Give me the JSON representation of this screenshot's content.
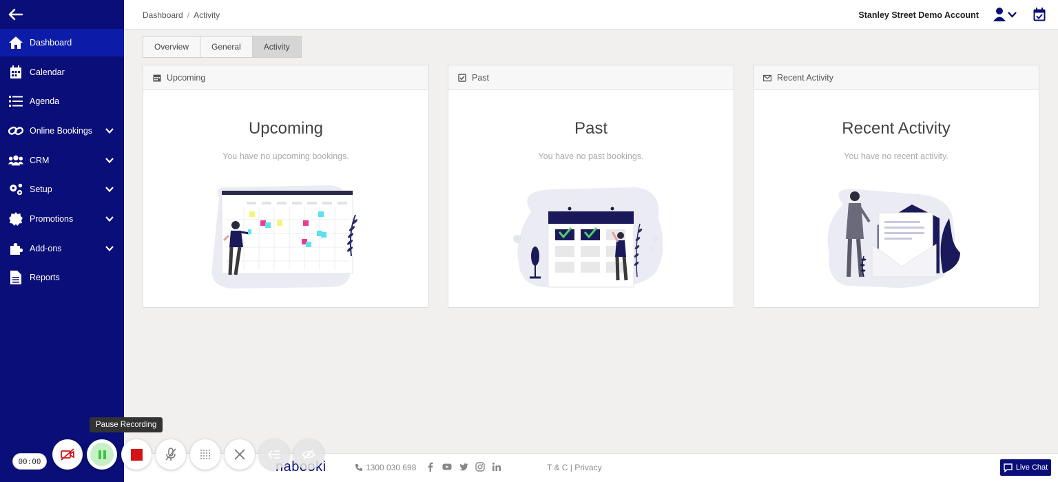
{
  "sidebar": {
    "items": [
      {
        "label": "Dashboard",
        "icon": "home-icon",
        "active": true
      },
      {
        "label": "Calendar",
        "icon": "calendar-icon"
      },
      {
        "label": "Agenda",
        "icon": "list-icon"
      },
      {
        "label": "Online Bookings",
        "icon": "link-icon",
        "expandable": true
      },
      {
        "label": "CRM",
        "icon": "users-icon",
        "expandable": true
      },
      {
        "label": "Setup",
        "icon": "cogs-icon",
        "expandable": true
      },
      {
        "label": "Promotions",
        "icon": "badge-icon",
        "expandable": true
      },
      {
        "label": "Add-ons",
        "icon": "puzzle-icon",
        "expandable": true
      },
      {
        "label": "Reports",
        "icon": "file-icon"
      }
    ]
  },
  "header": {
    "breadcrumb": {
      "root": "Dashboard",
      "sep": "/",
      "current": "Activity"
    },
    "account": "Stanley Street Demo Account"
  },
  "tabs": [
    {
      "label": "Overview"
    },
    {
      "label": "General"
    },
    {
      "label": "Activity",
      "active": true
    }
  ],
  "cards": [
    {
      "header": "Upcoming",
      "title": "Upcoming",
      "subtitle": "You have no upcoming bookings."
    },
    {
      "header": "Past",
      "title": "Past",
      "subtitle": "You have no past bookings."
    },
    {
      "header": "Recent Activity",
      "title": "Recent Activity",
      "subtitle": "You have no recent activity."
    }
  ],
  "footer": {
    "logo": "nabooki",
    "phone": "1300 030 698",
    "legal": "T & C | Privacy",
    "live_chat": "Live Chat"
  },
  "recorder": {
    "timer": "00:00",
    "tooltip": "Pause Recording"
  },
  "colors": {
    "sidebar": "#0a0e78",
    "active": "#0d1ca8",
    "stop": "#d41414",
    "pause": "#3cc43c"
  }
}
